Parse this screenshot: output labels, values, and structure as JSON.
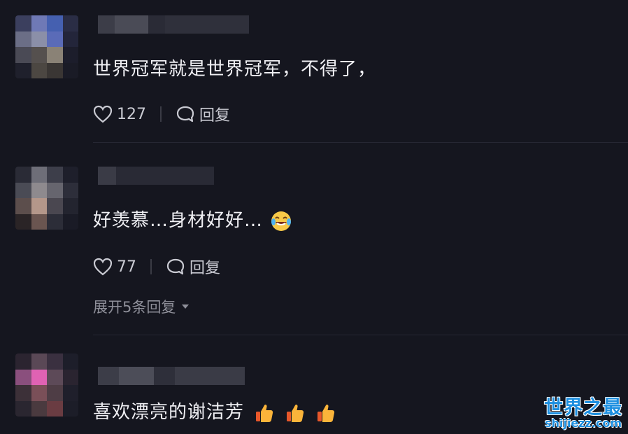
{
  "comments": [
    {
      "text": "世界冠军就是世界冠军，不得了，",
      "likes": "127",
      "reply_label": "回复"
    },
    {
      "text": "好羡慕…身材好好…",
      "emoji": "laugh-cry-emoji",
      "likes": "77",
      "reply_label": "回复",
      "expand_label": "展开5条回复"
    },
    {
      "text": "喜欢漂亮的谢洁芳",
      "emoji": "thumbs-up-emoji"
    }
  ],
  "watermark": {
    "title": "世界之最",
    "url": "shijiezz.com"
  },
  "colors": {
    "background": "#15161f",
    "text": "#f0f0f4",
    "muted": "#8e8f99",
    "watermark": "#1d8fe0"
  }
}
